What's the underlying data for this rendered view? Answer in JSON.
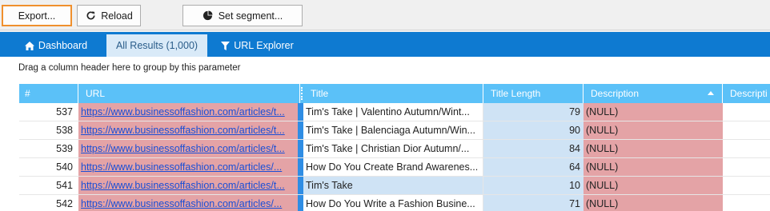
{
  "toolbar": {
    "export_label": "Export...",
    "reload_label": "Reload",
    "segment_label": "Set segment..."
  },
  "tabs": [
    {
      "label": "Dashboard",
      "icon": "home-icon"
    },
    {
      "label": "All Results (1,000)"
    },
    {
      "label": "URL Explorer",
      "icon": "filter-icon"
    }
  ],
  "grid": {
    "group_hint": "Drag a column header here to group by this parameter",
    "columns": [
      "#",
      "URL",
      "Title",
      "Title Length",
      "Description",
      "Descripti"
    ],
    "rows": [
      {
        "num": "537",
        "url": "https://www.businessoffashion.com/articles/t...",
        "title": "Tim's Take | Valentino Autumn/Wint...",
        "tlen": "79",
        "desc": "(NULL)"
      },
      {
        "num": "538",
        "url": "https://www.businessoffashion.com/articles/t...",
        "title": "Tim's Take | Balenciaga Autumn/Win...",
        "tlen": "90",
        "desc": "(NULL)"
      },
      {
        "num": "539",
        "url": "https://www.businessoffashion.com/articles/t...",
        "title": "Tim's Take | Christian Dior Autumn/...",
        "tlen": "84",
        "desc": "(NULL)"
      },
      {
        "num": "540",
        "url": "https://www.businessoffashion.com/articles/...",
        "title": "How Do You Create Brand Awarenes...",
        "tlen": "64",
        "desc": "(NULL)"
      },
      {
        "num": "541",
        "url": "https://www.businessoffashion.com/articles/t...",
        "title": "Tim's Take",
        "tlen": "10",
        "desc": "(NULL)"
      },
      {
        "num": "542",
        "url": "https://www.businessoffashion.com/articles/...",
        "title": "How Do You Write a Fashion Busine...",
        "tlen": "71",
        "desc": "(NULL)"
      }
    ]
  },
  "colors": {
    "tab_bar": "#0e7ad1",
    "header": "#5bc1f8",
    "url_fill": "#e4a3a6",
    "length_fill": "#cfe3f5",
    "focus": "#f0902d"
  }
}
